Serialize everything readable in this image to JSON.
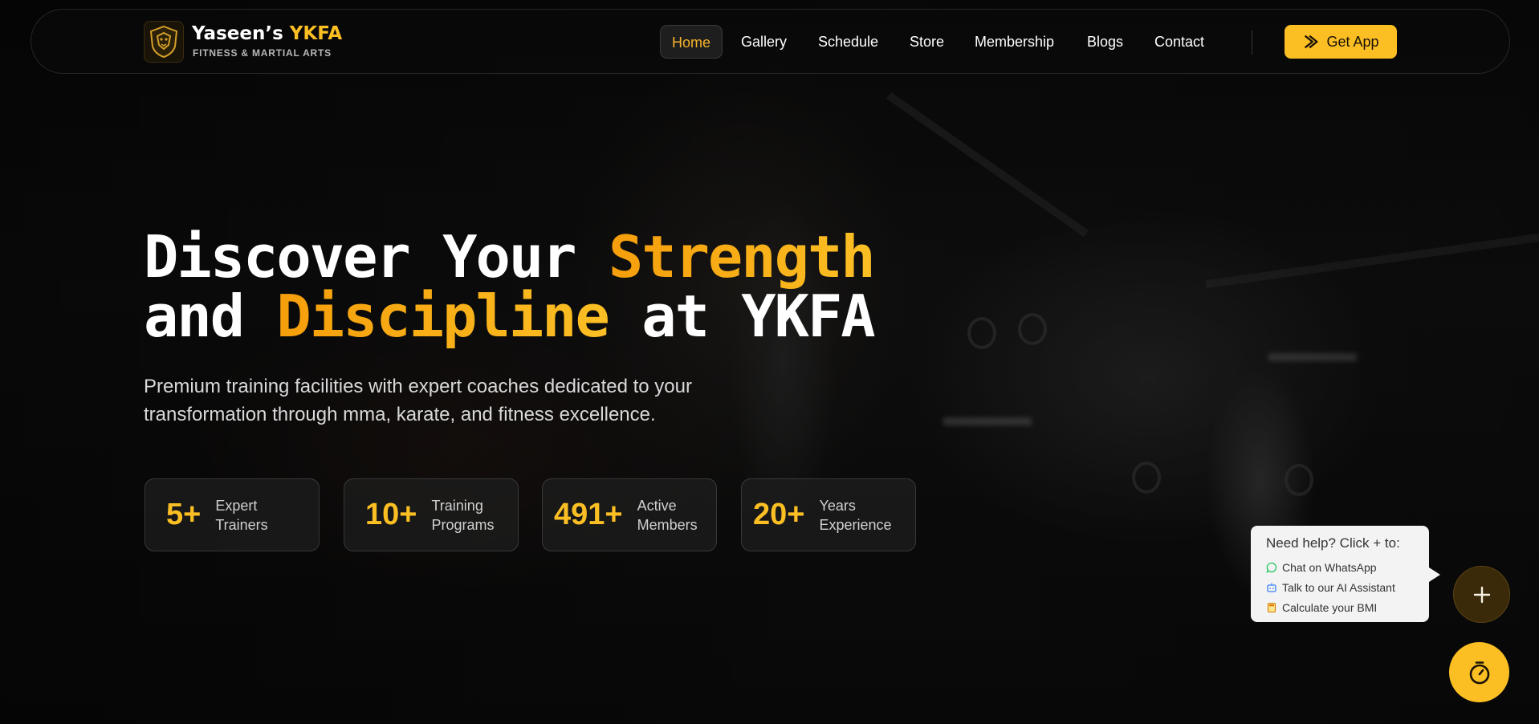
{
  "brand": {
    "name_main": "Yaseen’s",
    "name_accent": "YKFA",
    "tagline": "FITNESS & MARTIAL ARTS",
    "logo_icon": "lion-crest-logo"
  },
  "nav": {
    "items": [
      {
        "label": "Home",
        "active": true
      },
      {
        "label": "Gallery"
      },
      {
        "label": "Schedule"
      },
      {
        "label": "Store"
      },
      {
        "label": "Membership"
      },
      {
        "label": "Blogs"
      },
      {
        "label": "Contact"
      }
    ],
    "cta_label": "Get App",
    "cta_icon": "chevron-arrow-icon"
  },
  "hero": {
    "line1_a": "Discover Your ",
    "line1_hl": "Strength",
    "line2_a": "and ",
    "line2_hl": "Discipline",
    "line2_b": " at YKFA",
    "description": "Premium training facilities with expert coaches dedicated to your transformation through mma, karate, and fitness excellence."
  },
  "stats": [
    {
      "value": "5+",
      "label": "Expert Trainers"
    },
    {
      "value": "10+",
      "label": "Training Programs"
    },
    {
      "value": "491+",
      "label": "Active Members"
    },
    {
      "value": "20+",
      "label": "Years Experience"
    }
  ],
  "help": {
    "title": "Need help? Click + to:",
    "items": [
      {
        "label": "Chat on WhatsApp",
        "icon": "whatsapp-icon"
      },
      {
        "label": "Talk to our AI Assistant",
        "icon": "bot-icon"
      },
      {
        "label": "Calculate your BMI",
        "icon": "calculator-icon"
      }
    ]
  },
  "fabs": {
    "plus_icon": "plus-icon",
    "timer_icon": "timer-icon"
  },
  "colors": {
    "accent": "#fbbf24",
    "accent_dark": "#f59e0b",
    "background": "#070707"
  }
}
